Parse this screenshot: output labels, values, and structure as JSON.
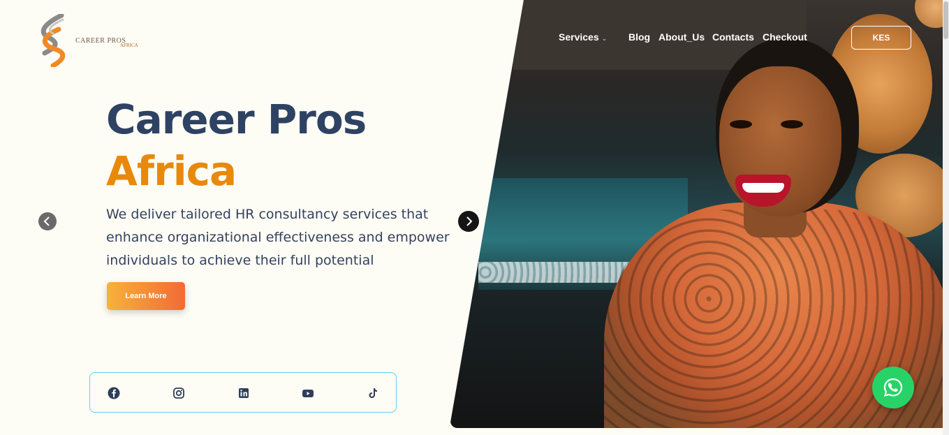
{
  "logo": {
    "text": "CAREER PROS",
    "sub": "AFRICA"
  },
  "nav": {
    "items": [
      {
        "label": "Services",
        "dropdown": true
      },
      {
        "label": "Blog"
      },
      {
        "label": "About_Us"
      },
      {
        "label": "Contacts"
      },
      {
        "label": "Checkout"
      }
    ],
    "currency": "KES"
  },
  "hero": {
    "title_line1": "Career Pros",
    "title_line2": "Africa",
    "description": "We deliver tailored HR consultancy services that enhance organizational effectiveness and empower individuals to achieve their full potential",
    "cta_label": "Learn More"
  },
  "social": [
    "facebook-icon",
    "instagram-icon",
    "linkedin-icon",
    "youtube-icon",
    "tiktok-icon"
  ],
  "colors": {
    "navy": "#2e4263",
    "orange": "#e8890c",
    "whatsapp": "#27d366",
    "social_border": "#5fd0f2"
  }
}
